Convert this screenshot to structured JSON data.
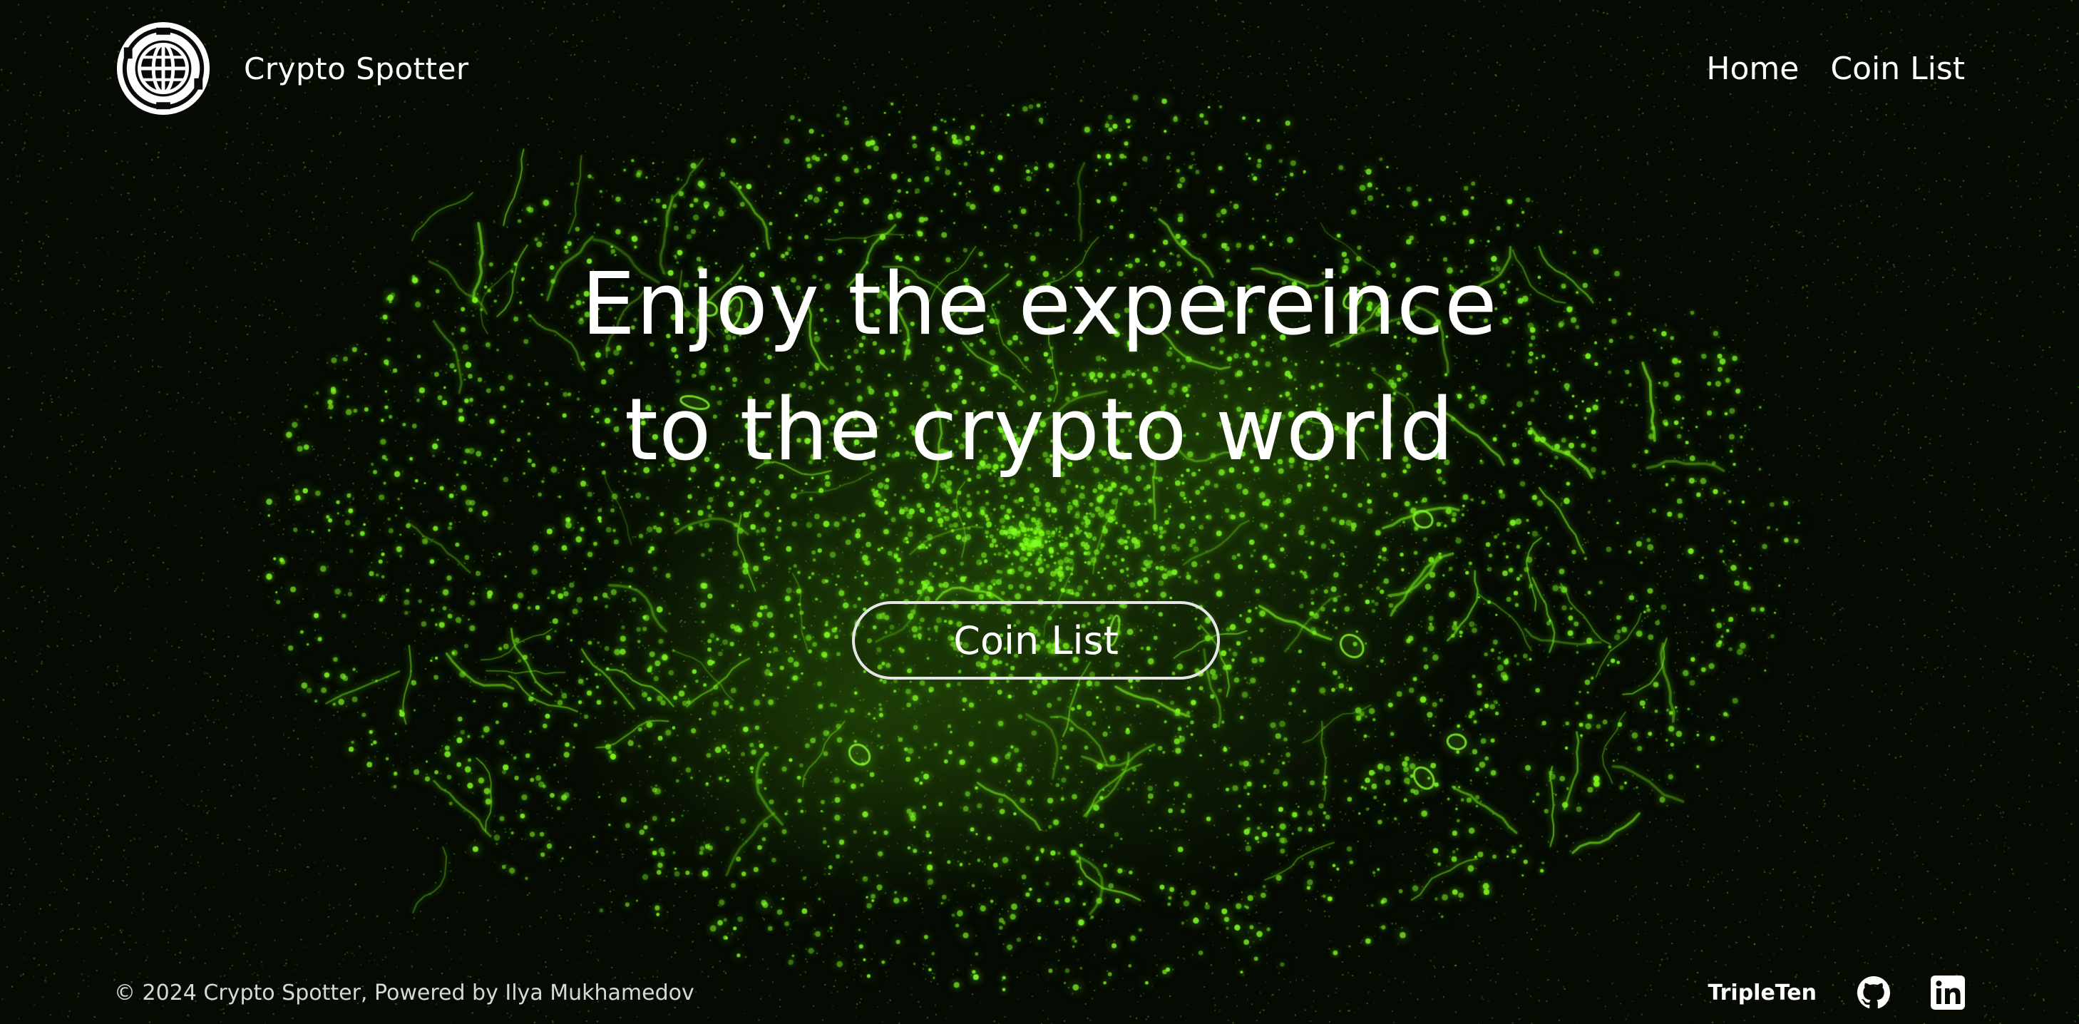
{
  "header": {
    "logo_icon": "globe-gear-logo-icon",
    "brand_name": "Crypto Spotter",
    "nav": [
      {
        "label": "Home"
      },
      {
        "label": "Coin List"
      }
    ]
  },
  "hero": {
    "title_line1": "Enjoy the expereince",
    "title_line2": "to the crypto world",
    "cta_label": "Coin List"
  },
  "footer": {
    "copyright": "© 2024 Crypto Spotter, Powered by Ilya Mukhamedov",
    "tripleten_label": "TripleTen",
    "github_icon": "github-icon",
    "linkedin_icon": "linkedin-icon"
  },
  "colors": {
    "background": "#050a03",
    "glow": "#7cff1a",
    "text": "#ffffff"
  }
}
